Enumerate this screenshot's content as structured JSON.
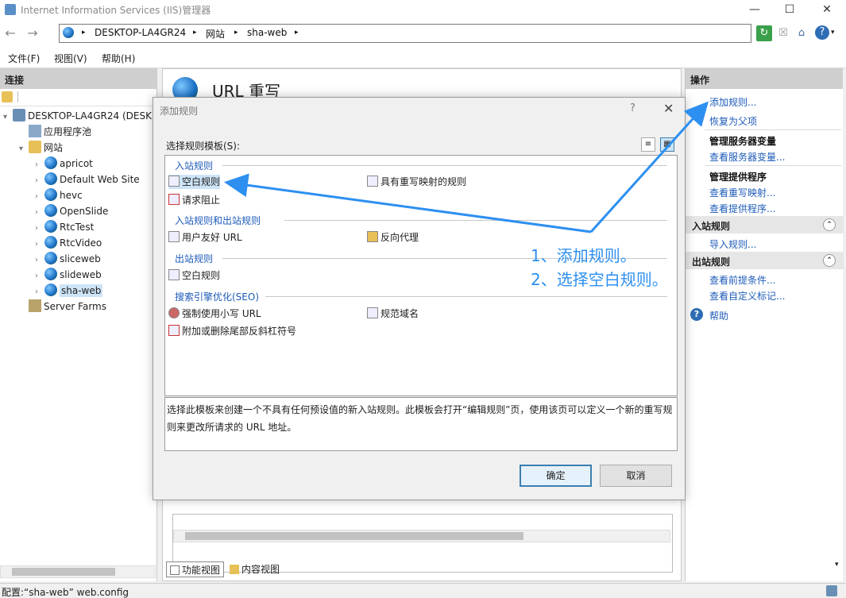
{
  "window": {
    "title": "Internet Information Services (IIS)管理器",
    "min": "—",
    "max": "☐",
    "close": "✕"
  },
  "address": {
    "segments": [
      "DESKTOP-LA4GR24",
      "网站",
      "sha-web"
    ],
    "separator": "▸"
  },
  "menu": {
    "items": [
      "文件(F)",
      "视图(V)",
      "帮助(H)"
    ]
  },
  "left_panel": {
    "title": "连接",
    "tree": [
      {
        "label": "DESKTOP-LA4GR24 (DESK",
        "level": 0,
        "expanded": true,
        "icon": "server-icon"
      },
      {
        "label": "应用程序池",
        "level": 1,
        "icon": "app-pool-icon"
      },
      {
        "label": "网站",
        "level": 1,
        "expanded": true,
        "icon": "folder-icon"
      },
      {
        "label": "apricot",
        "level": 2,
        "icon": "globe-icon"
      },
      {
        "label": "Default Web Site",
        "level": 2,
        "icon": "globe-icon"
      },
      {
        "label": "hevc",
        "level": 2,
        "icon": "globe-icon"
      },
      {
        "label": "OpenSlide",
        "level": 2,
        "icon": "globe-icon"
      },
      {
        "label": "RtcTest",
        "level": 2,
        "icon": "globe-icon"
      },
      {
        "label": "RtcVideo",
        "level": 2,
        "icon": "globe-icon"
      },
      {
        "label": "sliceweb",
        "level": 2,
        "icon": "globe-icon"
      },
      {
        "label": "slideweb",
        "level": 2,
        "icon": "globe-icon"
      },
      {
        "label": "sha-web",
        "level": 2,
        "icon": "globe-icon",
        "selected": true
      },
      {
        "label": "Server Farms",
        "level": 1,
        "icon": "server-farm-icon"
      }
    ]
  },
  "center": {
    "title": "URL 重写",
    "tabs": [
      "功能视图",
      "内容视图"
    ]
  },
  "right_panel": {
    "title": "操作",
    "add_rule": "添加规则...",
    "revert_parent": "恢复为父项",
    "server_vars_title": "管理服务器变量",
    "view_server_vars": "查看服务器变量...",
    "providers_title": "管理提供程序",
    "view_rewrite_maps": "查看重写映射...",
    "view_providers": "查看提供程序...",
    "inbound_section": "入站规则",
    "import_rules": "导入规则...",
    "outbound_section": "出站规则",
    "view_preconditions": "查看前提条件...",
    "view_custom_tags": "查看自定义标记...",
    "help": "帮助"
  },
  "dialog": {
    "title": "添加规则",
    "help": "?",
    "close": "✕",
    "select_label": "选择规则模板(S):",
    "groups": {
      "inbound": "入站规则",
      "inbound_outbound": "入站规则和出站规则",
      "outbound": "出站规则",
      "seo": "搜索引擎优化(SEO)"
    },
    "items": {
      "blank_rule": "空白规则",
      "rewrite_map_rule": "具有重写映射的规则",
      "request_blocking": "请求阻止",
      "user_friendly_url": "用户友好 URL",
      "reverse_proxy": "反向代理",
      "outbound_blank_rule": "空白规则",
      "lowercase_url": "强制使用小写 URL",
      "canonical_domain": "规范域名",
      "trailing_slash": "附加或删除尾部反斜杠符号"
    },
    "description": "选择此模板来创建一个不具有任何预设值的新入站规则。此模板会打开“编辑规则”页，使用该页可以定义一个新的重写规则来更改所请求的 URL 地址。",
    "ok": "确定",
    "cancel": "取消"
  },
  "annotation": {
    "step1": "1、添加规则。",
    "step2": "2、选择空白规则。",
    "color": "#2d8ff0"
  },
  "status": {
    "text": "配置:“sha-web” web.config"
  }
}
